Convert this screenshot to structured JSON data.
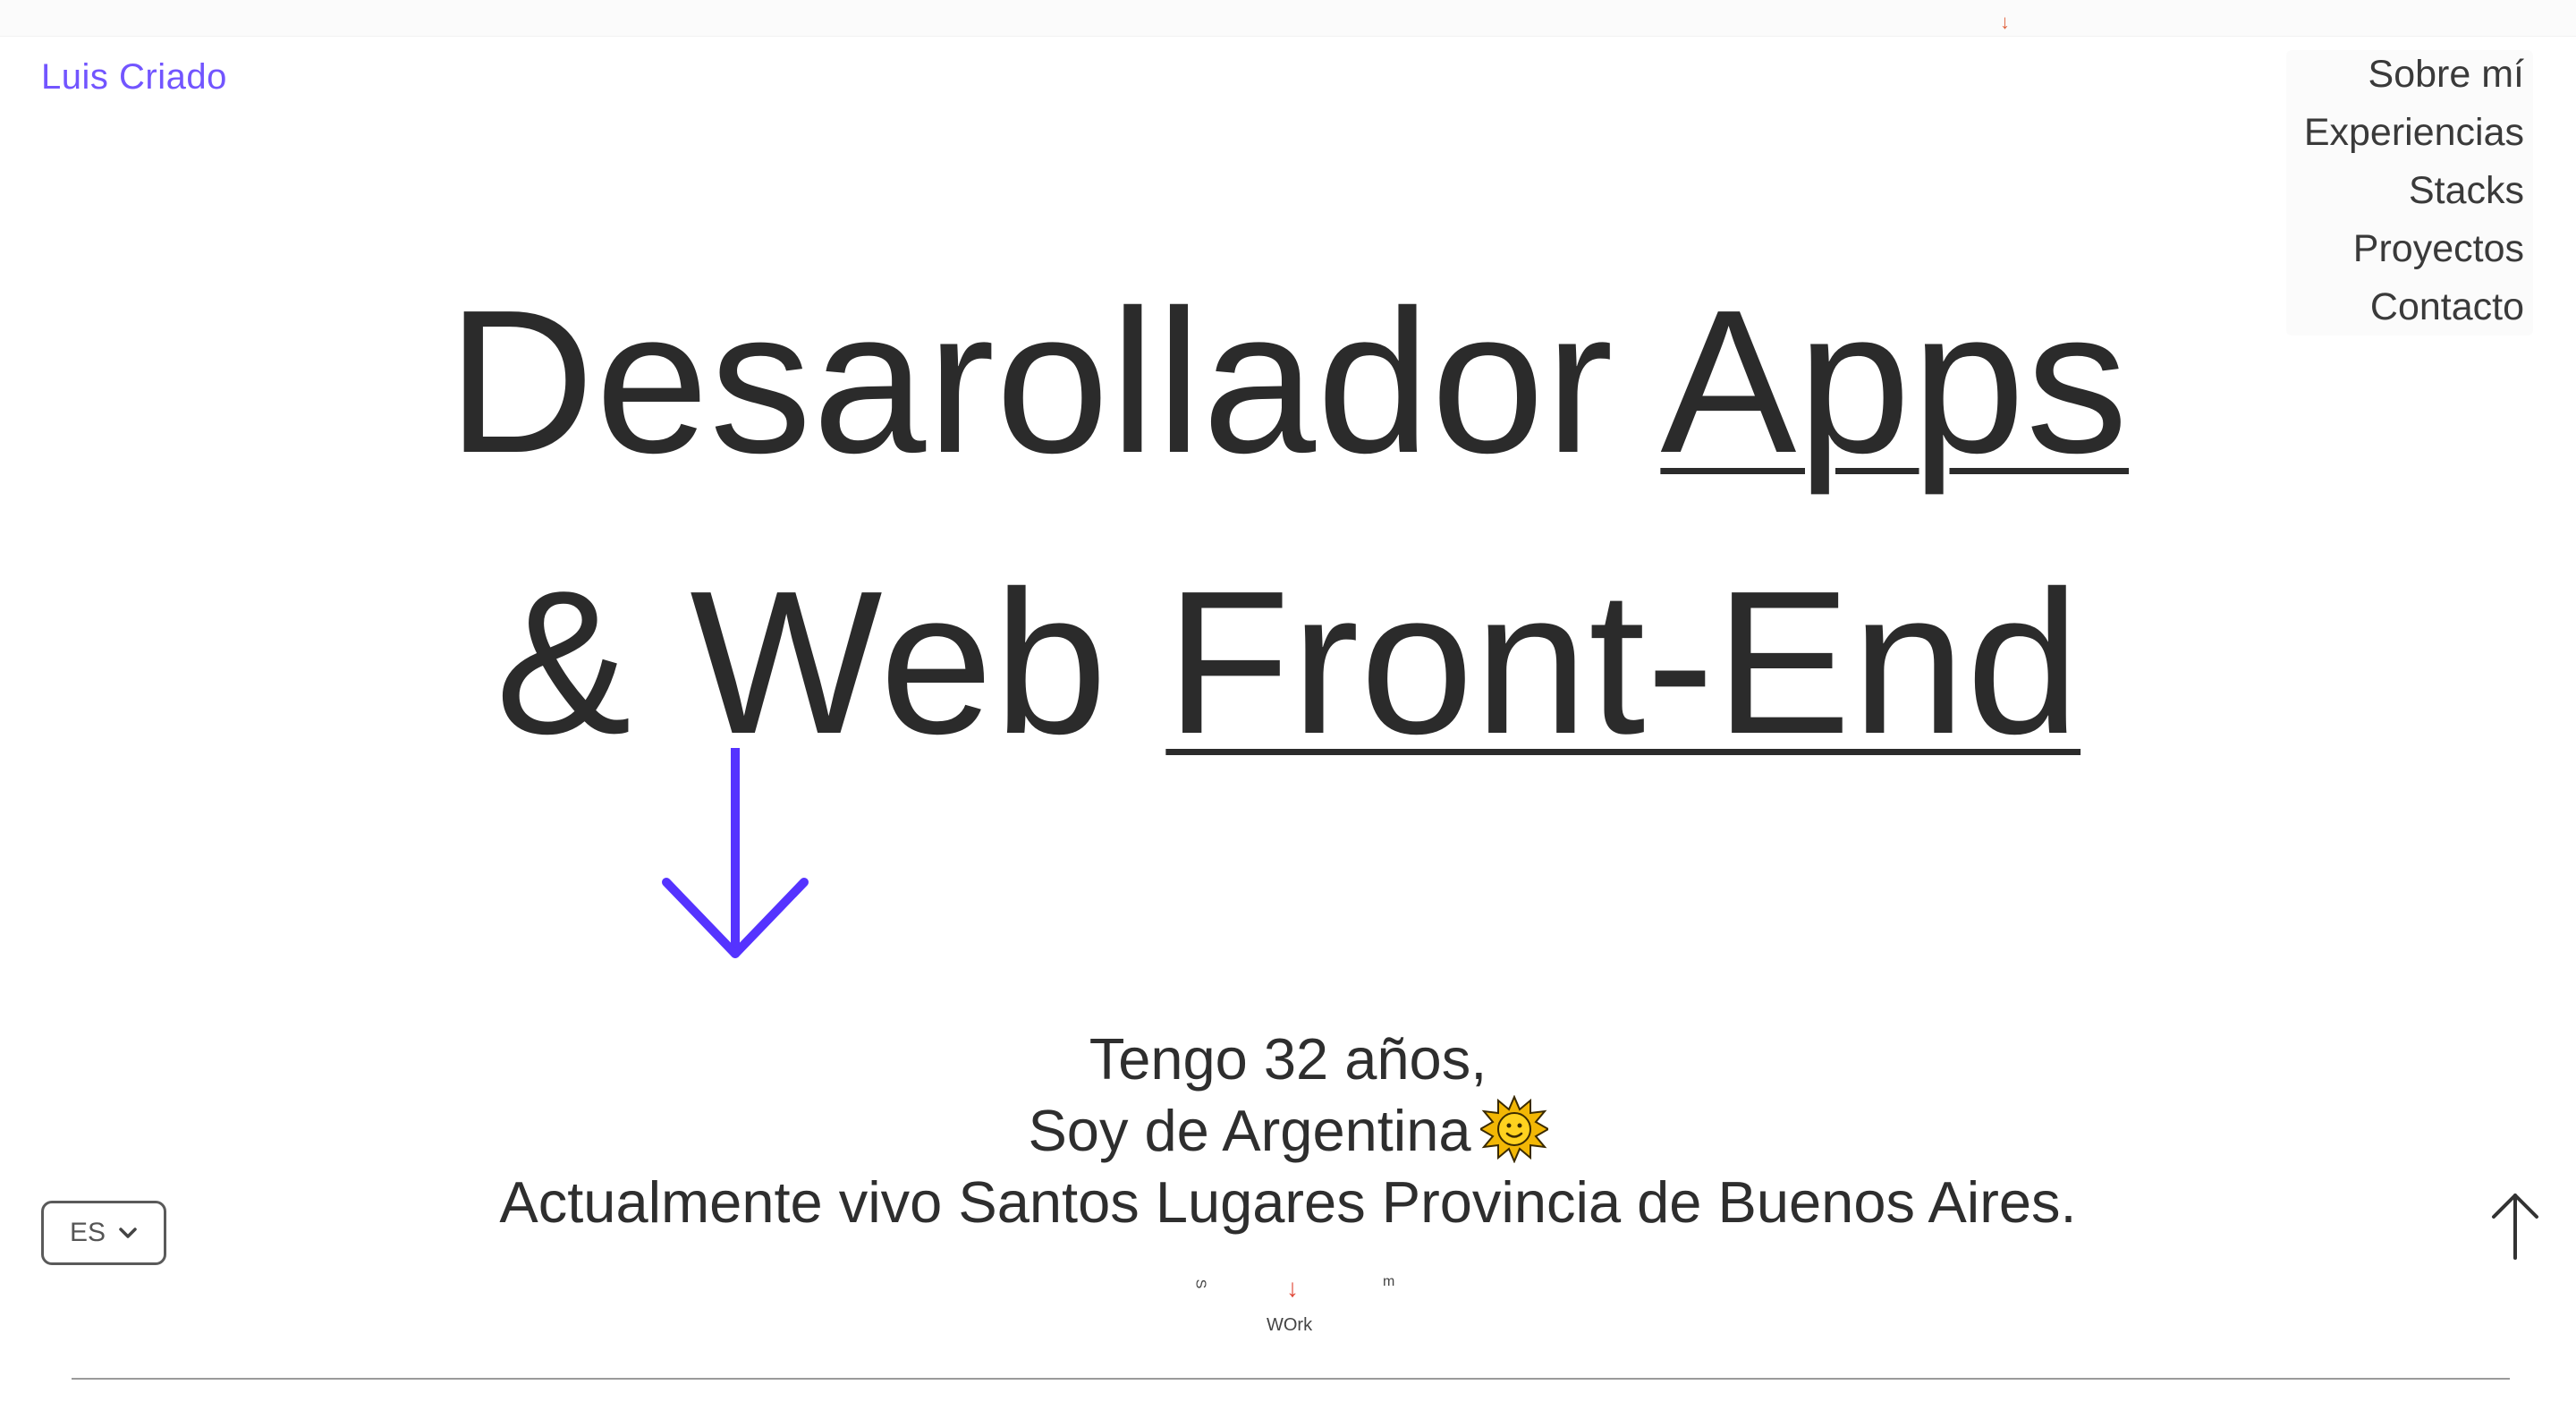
{
  "brand": {
    "name": "Luis Criado",
    "color": "#7255ff"
  },
  "nav": {
    "items": [
      {
        "label": "Sobre mí"
      },
      {
        "label": "Experiencias"
      },
      {
        "label": "Stacks"
      },
      {
        "label": "Proyectos"
      },
      {
        "label": "Contacto"
      }
    ]
  },
  "hero": {
    "line1_plain": "Desarollador ",
    "line1_underlined": "Apps",
    "line2_plain": "& Web ",
    "line2_underlined": "Front-End",
    "arrow_icon": "arrow-down-icon",
    "arrow_color": "#5533ff"
  },
  "bio": {
    "line1": "Tengo 32 años,",
    "line2": "Soy de Argentina",
    "line2_icon": "sun-icon",
    "line3": "Actualmente vivo Santos Lugares Provincia de Buenos Aires."
  },
  "language_select": {
    "value": "ES",
    "icon": "chevron-down-icon"
  },
  "scroll_top": {
    "icon": "arrow-up-icon"
  },
  "work_marker": {
    "label": "WOrk",
    "left_glyph": "S",
    "right_glyph": "m",
    "arrow": "↓"
  },
  "top_marker": {
    "arrow": "↓"
  }
}
